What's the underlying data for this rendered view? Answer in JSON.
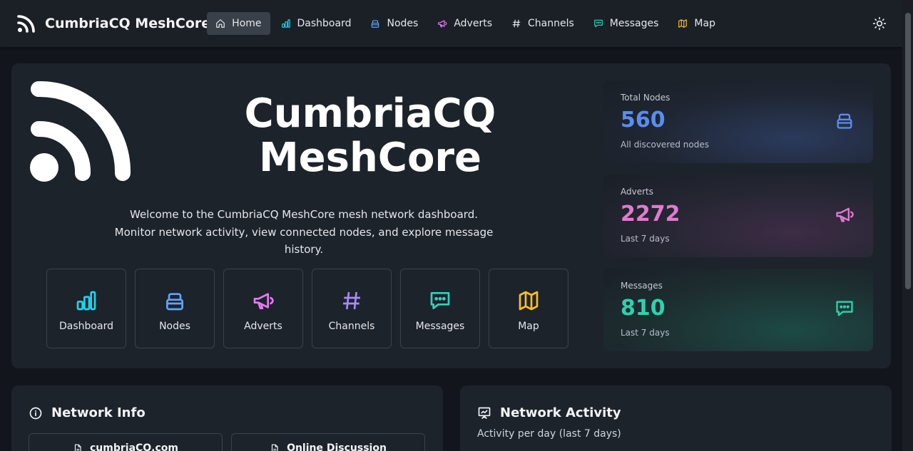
{
  "navbar": {
    "brand": "CumbriaCQ MeshCore",
    "items": [
      {
        "label": "Home",
        "icon": "home-icon",
        "active": true
      },
      {
        "label": "Dashboard",
        "icon": "bar-chart-icon",
        "color": "#22d3ee"
      },
      {
        "label": "Nodes",
        "icon": "stack-icon",
        "color": "#60a5fa"
      },
      {
        "label": "Adverts",
        "icon": "megaphone-icon",
        "color": "#e879f9"
      },
      {
        "label": "Channels",
        "icon": "hash-icon",
        "color": "#e5e7eb"
      },
      {
        "label": "Messages",
        "icon": "message-icon",
        "color": "#2dd4bf"
      },
      {
        "label": "Map",
        "icon": "map-icon",
        "color": "#fbbf24"
      }
    ],
    "theme_toggle": "sun-icon"
  },
  "hero": {
    "title_line1": "CumbriaCQ",
    "title_line2": "MeshCore",
    "description": "Welcome to the CumbriaCQ MeshCore mesh network dashboard. Monitor network activity, view connected nodes, and explore message history.",
    "quick_links": [
      {
        "label": "Dashboard",
        "icon": "bar-chart-icon",
        "color": "#22d3ee"
      },
      {
        "label": "Nodes",
        "icon": "stack-icon",
        "color": "#60a5fa"
      },
      {
        "label": "Adverts",
        "icon": "megaphone-icon",
        "color": "#e879f9"
      },
      {
        "label": "Channels",
        "icon": "hash-icon",
        "color": "#a78bfa"
      },
      {
        "label": "Messages",
        "icon": "message-icon",
        "color": "#2dd4bf"
      },
      {
        "label": "Map",
        "icon": "map-icon",
        "color": "#fbbf24"
      }
    ]
  },
  "stats": [
    {
      "label": "Total Nodes",
      "value": "560",
      "sub": "All discovered nodes",
      "color": "#5b8def",
      "icon": "stack-icon"
    },
    {
      "label": "Adverts",
      "value": "2272",
      "sub": "Last 7 days",
      "color": "#e07ad0",
      "icon": "megaphone-icon"
    },
    {
      "label": "Messages",
      "value": "810",
      "sub": "Last 7 days",
      "color": "#2ed1ad",
      "icon": "message-icon"
    }
  ],
  "network_info": {
    "title": "Network Info",
    "links": [
      "cumbriaCQ.com",
      "Online Discussion"
    ]
  },
  "network_activity": {
    "title": "Network Activity",
    "subtitle": "Activity per day (last 7 days)"
  }
}
